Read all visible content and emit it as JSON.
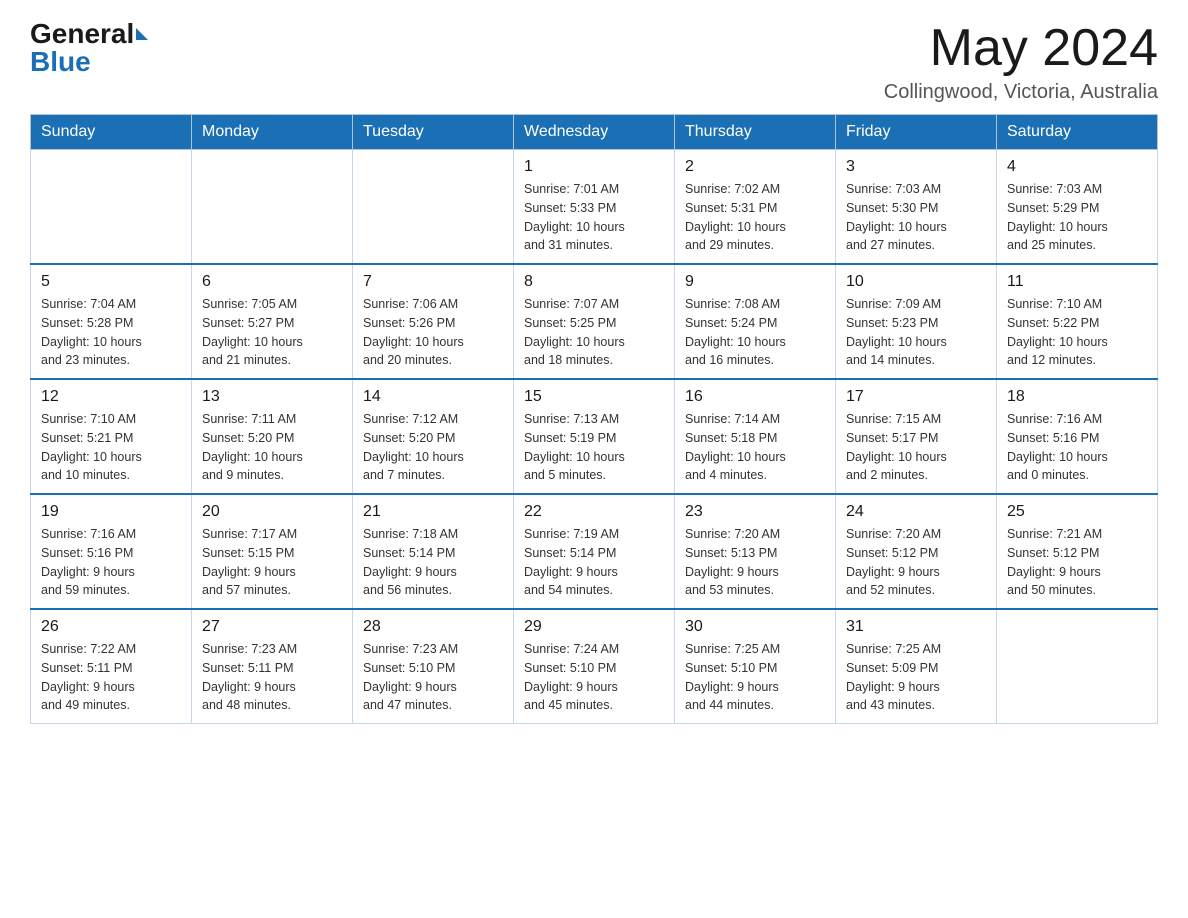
{
  "header": {
    "logo_general": "General",
    "logo_blue": "Blue",
    "month": "May 2024",
    "location": "Collingwood, Victoria, Australia"
  },
  "days_of_week": [
    "Sunday",
    "Monday",
    "Tuesday",
    "Wednesday",
    "Thursday",
    "Friday",
    "Saturday"
  ],
  "weeks": [
    {
      "days": [
        {
          "number": "",
          "info": ""
        },
        {
          "number": "",
          "info": ""
        },
        {
          "number": "",
          "info": ""
        },
        {
          "number": "1",
          "info": "Sunrise: 7:01 AM\nSunset: 5:33 PM\nDaylight: 10 hours\nand 31 minutes."
        },
        {
          "number": "2",
          "info": "Sunrise: 7:02 AM\nSunset: 5:31 PM\nDaylight: 10 hours\nand 29 minutes."
        },
        {
          "number": "3",
          "info": "Sunrise: 7:03 AM\nSunset: 5:30 PM\nDaylight: 10 hours\nand 27 minutes."
        },
        {
          "number": "4",
          "info": "Sunrise: 7:03 AM\nSunset: 5:29 PM\nDaylight: 10 hours\nand 25 minutes."
        }
      ]
    },
    {
      "days": [
        {
          "number": "5",
          "info": "Sunrise: 7:04 AM\nSunset: 5:28 PM\nDaylight: 10 hours\nand 23 minutes."
        },
        {
          "number": "6",
          "info": "Sunrise: 7:05 AM\nSunset: 5:27 PM\nDaylight: 10 hours\nand 21 minutes."
        },
        {
          "number": "7",
          "info": "Sunrise: 7:06 AM\nSunset: 5:26 PM\nDaylight: 10 hours\nand 20 minutes."
        },
        {
          "number": "8",
          "info": "Sunrise: 7:07 AM\nSunset: 5:25 PM\nDaylight: 10 hours\nand 18 minutes."
        },
        {
          "number": "9",
          "info": "Sunrise: 7:08 AM\nSunset: 5:24 PM\nDaylight: 10 hours\nand 16 minutes."
        },
        {
          "number": "10",
          "info": "Sunrise: 7:09 AM\nSunset: 5:23 PM\nDaylight: 10 hours\nand 14 minutes."
        },
        {
          "number": "11",
          "info": "Sunrise: 7:10 AM\nSunset: 5:22 PM\nDaylight: 10 hours\nand 12 minutes."
        }
      ]
    },
    {
      "days": [
        {
          "number": "12",
          "info": "Sunrise: 7:10 AM\nSunset: 5:21 PM\nDaylight: 10 hours\nand 10 minutes."
        },
        {
          "number": "13",
          "info": "Sunrise: 7:11 AM\nSunset: 5:20 PM\nDaylight: 10 hours\nand 9 minutes."
        },
        {
          "number": "14",
          "info": "Sunrise: 7:12 AM\nSunset: 5:20 PM\nDaylight: 10 hours\nand 7 minutes."
        },
        {
          "number": "15",
          "info": "Sunrise: 7:13 AM\nSunset: 5:19 PM\nDaylight: 10 hours\nand 5 minutes."
        },
        {
          "number": "16",
          "info": "Sunrise: 7:14 AM\nSunset: 5:18 PM\nDaylight: 10 hours\nand 4 minutes."
        },
        {
          "number": "17",
          "info": "Sunrise: 7:15 AM\nSunset: 5:17 PM\nDaylight: 10 hours\nand 2 minutes."
        },
        {
          "number": "18",
          "info": "Sunrise: 7:16 AM\nSunset: 5:16 PM\nDaylight: 10 hours\nand 0 minutes."
        }
      ]
    },
    {
      "days": [
        {
          "number": "19",
          "info": "Sunrise: 7:16 AM\nSunset: 5:16 PM\nDaylight: 9 hours\nand 59 minutes."
        },
        {
          "number": "20",
          "info": "Sunrise: 7:17 AM\nSunset: 5:15 PM\nDaylight: 9 hours\nand 57 minutes."
        },
        {
          "number": "21",
          "info": "Sunrise: 7:18 AM\nSunset: 5:14 PM\nDaylight: 9 hours\nand 56 minutes."
        },
        {
          "number": "22",
          "info": "Sunrise: 7:19 AM\nSunset: 5:14 PM\nDaylight: 9 hours\nand 54 minutes."
        },
        {
          "number": "23",
          "info": "Sunrise: 7:20 AM\nSunset: 5:13 PM\nDaylight: 9 hours\nand 53 minutes."
        },
        {
          "number": "24",
          "info": "Sunrise: 7:20 AM\nSunset: 5:12 PM\nDaylight: 9 hours\nand 52 minutes."
        },
        {
          "number": "25",
          "info": "Sunrise: 7:21 AM\nSunset: 5:12 PM\nDaylight: 9 hours\nand 50 minutes."
        }
      ]
    },
    {
      "days": [
        {
          "number": "26",
          "info": "Sunrise: 7:22 AM\nSunset: 5:11 PM\nDaylight: 9 hours\nand 49 minutes."
        },
        {
          "number": "27",
          "info": "Sunrise: 7:23 AM\nSunset: 5:11 PM\nDaylight: 9 hours\nand 48 minutes."
        },
        {
          "number": "28",
          "info": "Sunrise: 7:23 AM\nSunset: 5:10 PM\nDaylight: 9 hours\nand 47 minutes."
        },
        {
          "number": "29",
          "info": "Sunrise: 7:24 AM\nSunset: 5:10 PM\nDaylight: 9 hours\nand 45 minutes."
        },
        {
          "number": "30",
          "info": "Sunrise: 7:25 AM\nSunset: 5:10 PM\nDaylight: 9 hours\nand 44 minutes."
        },
        {
          "number": "31",
          "info": "Sunrise: 7:25 AM\nSunset: 5:09 PM\nDaylight: 9 hours\nand 43 minutes."
        },
        {
          "number": "",
          "info": ""
        }
      ]
    }
  ]
}
